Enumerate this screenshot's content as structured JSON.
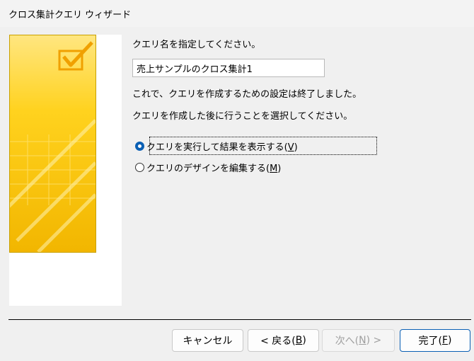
{
  "window": {
    "title": "クロス集計クエリ ウィザード"
  },
  "prompt_query_name": "クエリ名を指定してください。",
  "query_name_value": "売上サンプルのクロス集計1",
  "completion_message": "これで、クエリを作成するための設定は終了しました。",
  "next_action_prompt": "クエリを作成した後に行うことを選択してください。",
  "options": [
    {
      "label": "クエリを実行して結果を表示する(",
      "mnemonic": "V",
      "suffix": ")",
      "checked": true
    },
    {
      "label": "クエリのデザインを編集する(",
      "mnemonic": "M",
      "suffix": ")",
      "checked": false
    }
  ],
  "buttons": {
    "cancel": {
      "label": "キャンセル"
    },
    "back": {
      "label": "< 戻る(",
      "mnemonic": "B",
      "suffix": ")"
    },
    "next": {
      "label": "次へ(",
      "mnemonic": "N",
      "suffix": ") >",
      "disabled": true
    },
    "finish": {
      "label": "完了(",
      "mnemonic": "F",
      "suffix": ")"
    }
  },
  "colors": {
    "accent": "#0a5fb4",
    "art_yellow": "#ffd21e",
    "art_dark": "#f0b400"
  },
  "icons": {
    "art": "checkmark-illustration-icon"
  }
}
